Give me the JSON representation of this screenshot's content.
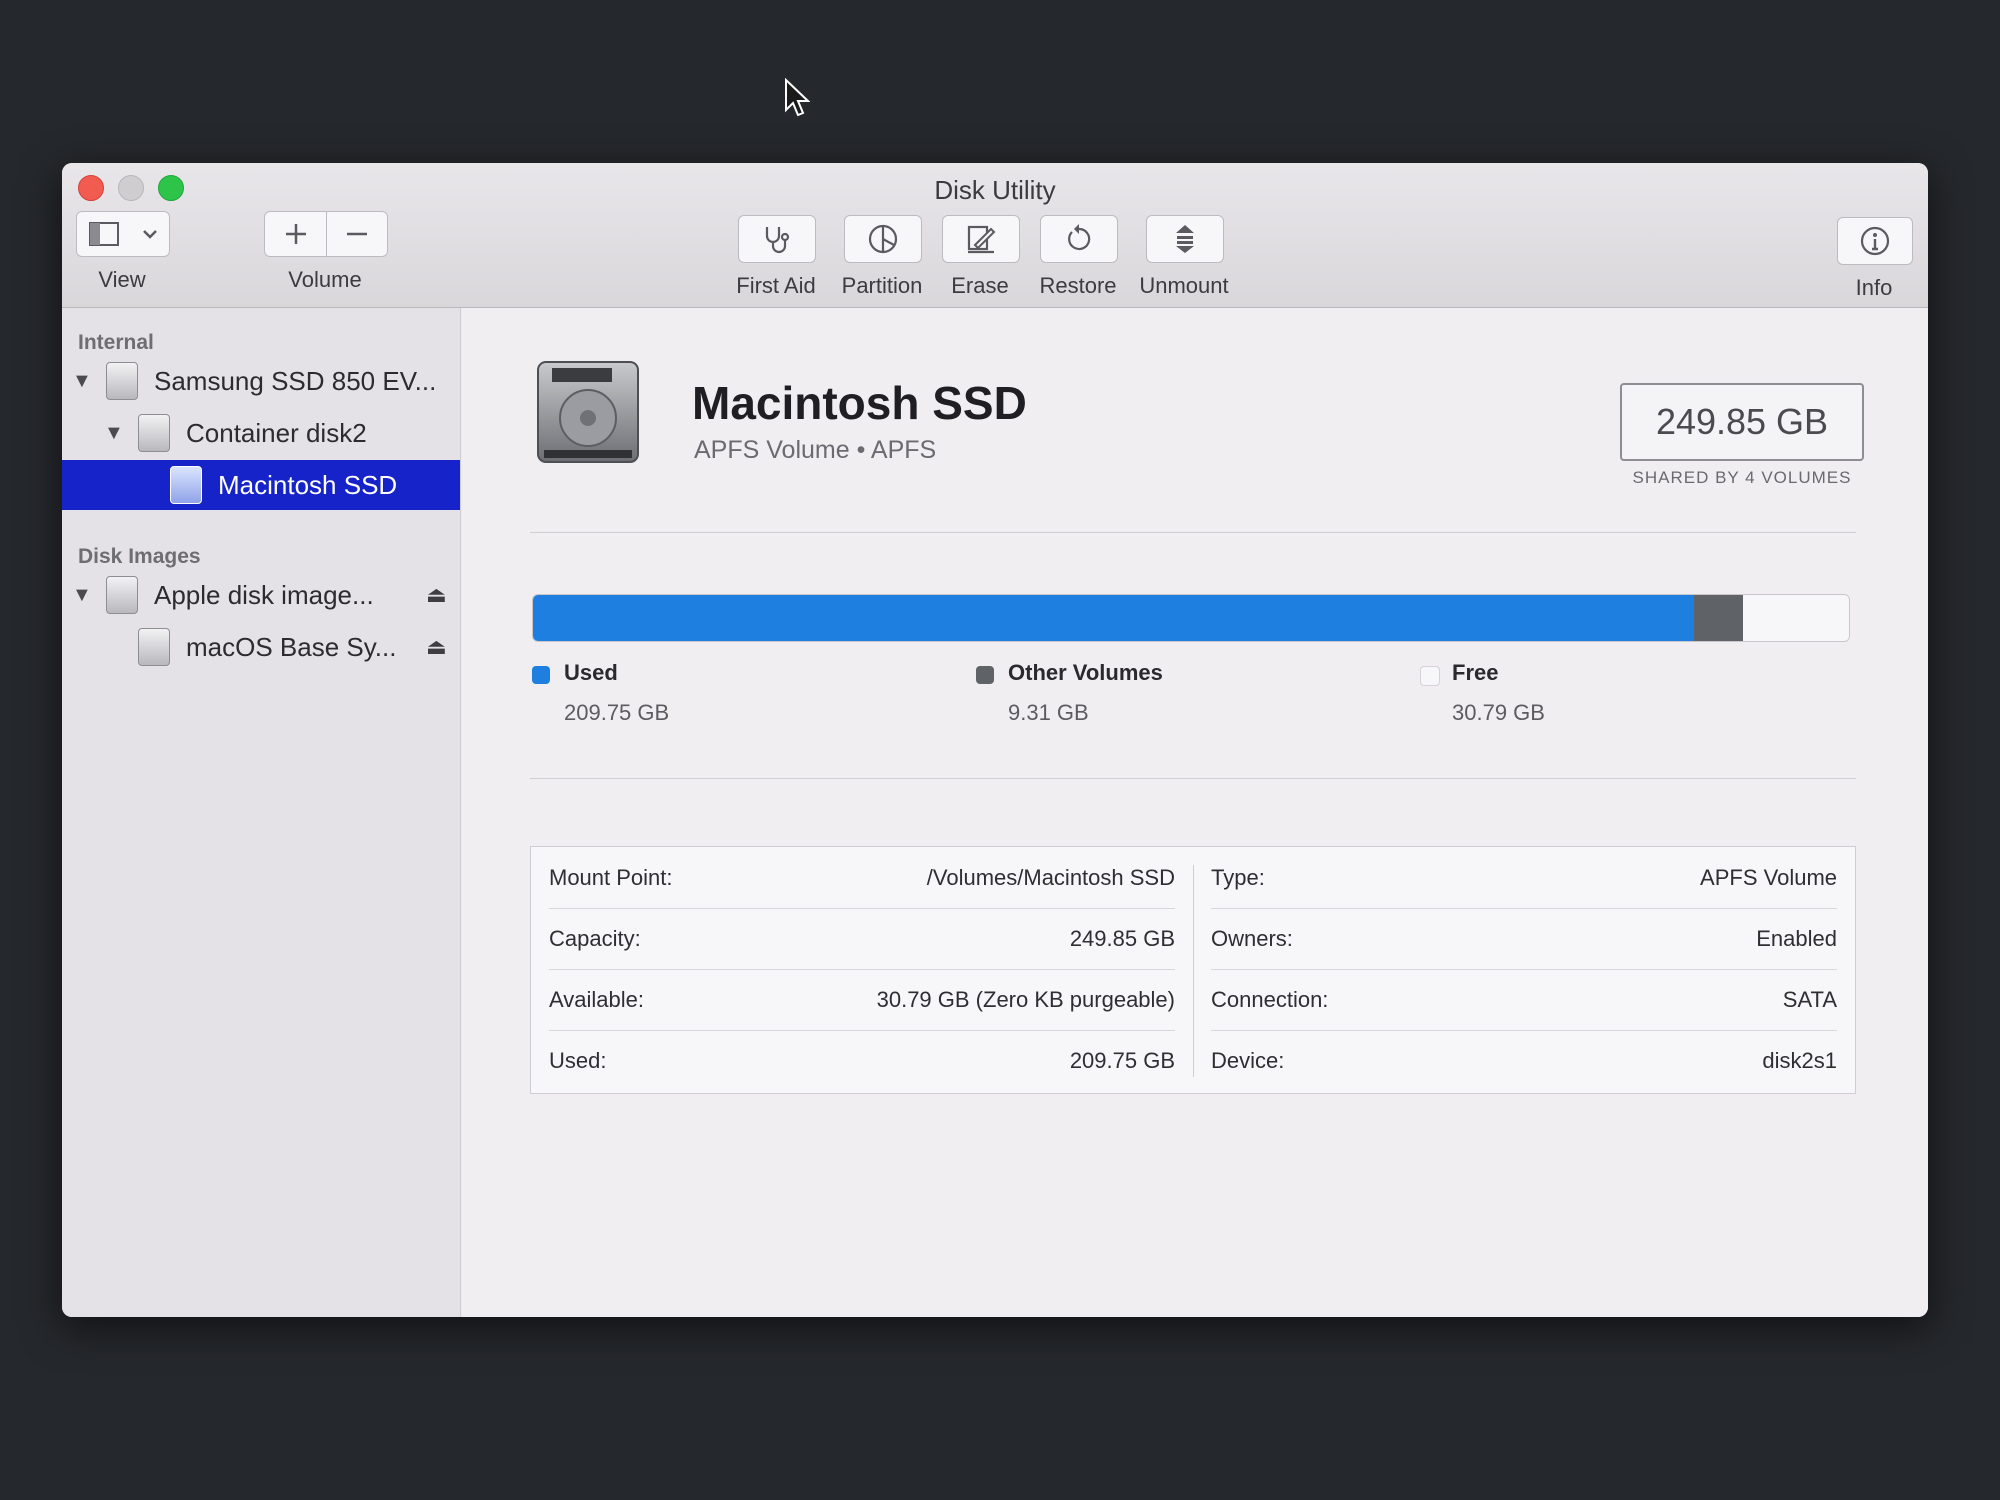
{
  "window": {
    "title": "Disk Utility"
  },
  "toolbar": {
    "view_label": "View",
    "volume_label": "Volume",
    "first_aid_label": "First Aid",
    "partition_label": "Partition",
    "erase_label": "Erase",
    "restore_label": "Restore",
    "unmount_label": "Unmount",
    "info_label": "Info"
  },
  "sidebar": {
    "internal_header": "Internal",
    "disk_images_header": "Disk Images",
    "items": [
      {
        "label": "Samsung SSD 850 EV...",
        "level": 0,
        "expanded": true
      },
      {
        "label": "Container disk2",
        "level": 1,
        "expanded": true
      },
      {
        "label": "Macintosh SSD",
        "level": 2,
        "selected": true
      },
      {
        "label": "Apple disk image...",
        "level": 0,
        "expanded": true,
        "ejectable": true
      },
      {
        "label": "macOS Base Sy...",
        "level": 1,
        "ejectable": true
      }
    ]
  },
  "volume": {
    "name": "Macintosh SSD",
    "subtitle": "APFS Volume • APFS",
    "capacity": "249.85 GB",
    "shared_note": "SHARED BY 4 VOLUMES"
  },
  "usage": {
    "segments": [
      {
        "name": "Used",
        "value": "209.75 GB",
        "fraction": 0.8825,
        "color": "#1e7fe0"
      },
      {
        "name": "Other Volumes",
        "value": "9.31 GB",
        "fraction": 0.0366,
        "color": "#5f6266"
      },
      {
        "name": "Free",
        "value": "30.79 GB",
        "fraction": 0.0809,
        "color": "#f7f6f8"
      }
    ]
  },
  "details": {
    "left": [
      {
        "label": "Mount Point:",
        "value": "/Volumes/Macintosh SSD"
      },
      {
        "label": "Capacity:",
        "value": "249.85 GB"
      },
      {
        "label": "Available:",
        "value": "30.79 GB (Zero KB purgeable)"
      },
      {
        "label": "Used:",
        "value": "209.75 GB"
      }
    ],
    "right": [
      {
        "label": "Type:",
        "value": "APFS Volume"
      },
      {
        "label": "Owners:",
        "value": "Enabled"
      },
      {
        "label": "Connection:",
        "value": "SATA"
      },
      {
        "label": "Device:",
        "value": "disk2s1"
      }
    ]
  },
  "icons": {
    "view": "sidebar-icon",
    "add": "plus-icon",
    "remove": "minus-icon",
    "first_aid": "stethoscope-icon",
    "partition": "pie-icon",
    "erase": "erase-icon",
    "restore": "restore-icon",
    "unmount": "unmount-icon",
    "info": "info-icon"
  }
}
